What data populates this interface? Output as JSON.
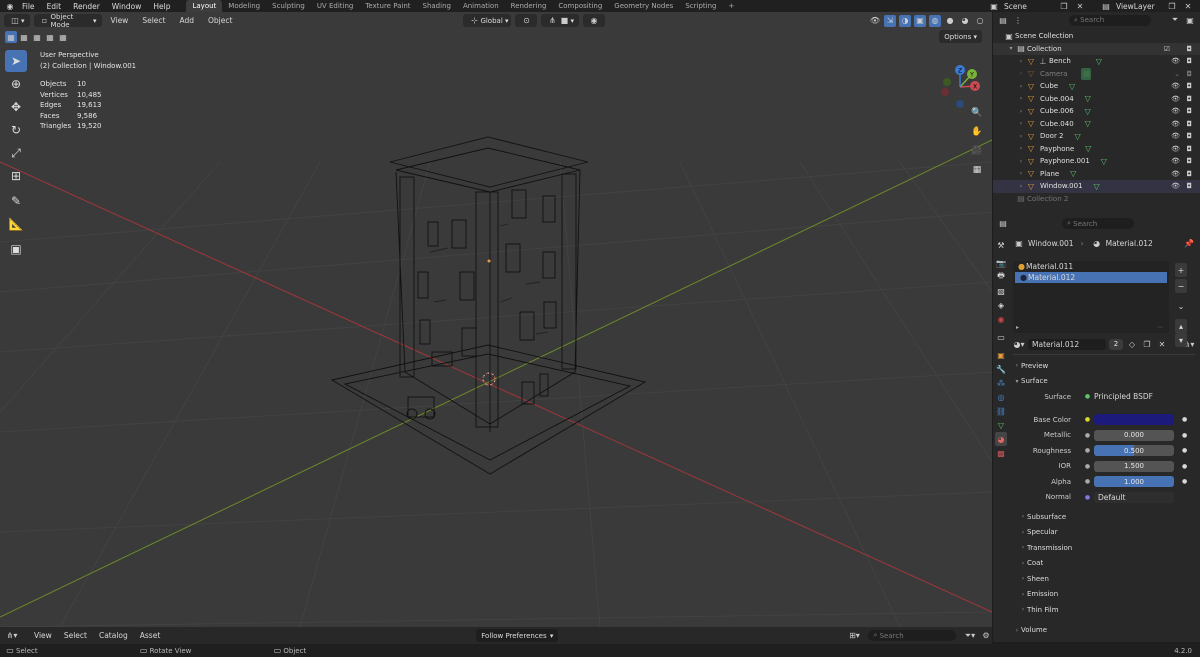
{
  "menu": {
    "items": [
      "File",
      "Edit",
      "Render",
      "Window",
      "Help"
    ],
    "workspaces": [
      "Layout",
      "Modeling",
      "Sculpting",
      "UV Editing",
      "Texture Paint",
      "Shading",
      "Animation",
      "Rendering",
      "Compositing",
      "Geometry Nodes",
      "Scripting"
    ],
    "active_workspace": "Layout",
    "add_tab": "+",
    "scene": "Scene",
    "view_layer": "ViewLayer"
  },
  "viewport_header": {
    "mode": "Object Mode",
    "menus": [
      "View",
      "Select",
      "Add",
      "Object"
    ],
    "orientation": "Global",
    "options": "Options"
  },
  "overlay": {
    "view_name": "User Perspective",
    "collection_line": "(2) Collection | Window.001",
    "stats": [
      {
        "label": "Objects",
        "value": "10"
      },
      {
        "label": "Vertices",
        "value": "10,485"
      },
      {
        "label": "Edges",
        "value": "19,613"
      },
      {
        "label": "Faces",
        "value": "9,586"
      },
      {
        "label": "Triangles",
        "value": "19,520"
      }
    ]
  },
  "gizmo": {
    "x": "X",
    "y": "Y",
    "z": "Z"
  },
  "outliner": {
    "search_placeholder": "Search",
    "scene_collection": "Scene Collection",
    "collection": "Collection",
    "items": [
      {
        "name": "Bench",
        "dim": false
      },
      {
        "name": "Camera",
        "dim": true
      },
      {
        "name": "Cube",
        "dim": false
      },
      {
        "name": "Cube.004",
        "dim": false
      },
      {
        "name": "Cube.006",
        "dim": false
      },
      {
        "name": "Cube.040",
        "dim": false
      },
      {
        "name": "Door 2",
        "dim": false
      },
      {
        "name": "Payphone",
        "dim": false
      },
      {
        "name": "Payphone.001",
        "dim": false
      },
      {
        "name": "Plane",
        "dim": false
      },
      {
        "name": "Window.001",
        "dim": false
      }
    ],
    "collection2": "Collection 2"
  },
  "properties": {
    "search_placeholder": "Search",
    "breadcrumb_object": "Window.001",
    "breadcrumb_material": "Material.012",
    "slots": [
      "Material.011",
      "Material.012"
    ],
    "material_name": "Material.012",
    "user_count": "2",
    "preview_label": "Preview",
    "surface_panel": "Surface",
    "surface_label": "Surface",
    "surface_value": "Principled BSDF",
    "base_color_label": "Base Color",
    "base_color": "#1c1a7a",
    "metallic_label": "Metallic",
    "metallic": "0.000",
    "roughness_label": "Roughness",
    "roughness": "0.500",
    "roughness_fill": 0.5,
    "ior_label": "IOR",
    "ior": "1.500",
    "alpha_label": "Alpha",
    "alpha": "1.000",
    "alpha_fill": 1.0,
    "normal_label": "Normal",
    "normal_value": "Default",
    "subpanels": [
      "Subsurface",
      "Specular",
      "Transmission",
      "Coat",
      "Sheen",
      "Emission",
      "Thin Film"
    ],
    "volume": "Volume"
  },
  "asset_bar": {
    "menus": [
      "View",
      "Select",
      "Catalog",
      "Asset"
    ],
    "preferences": "Follow Preferences",
    "search_placeholder": "Search"
  },
  "status_bar": {
    "select": "Select",
    "rotate": "Rotate View",
    "object": "Object",
    "version": "4.2.0"
  },
  "colors": {
    "accent": "#4772b3",
    "x_axis": "#a0363d",
    "y_axis": "#6a8a2a"
  }
}
